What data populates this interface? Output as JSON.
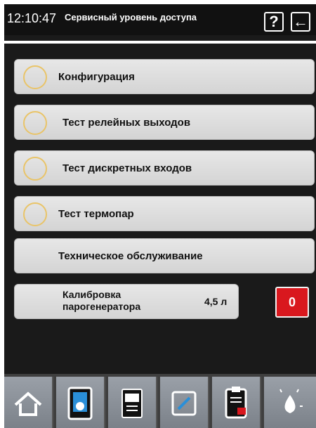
{
  "header": {
    "time": "12:10:47",
    "title": "Сервисный уровень доступа",
    "help_label": "?",
    "back_label": "←"
  },
  "menu": [
    {
      "label": "Конфигурация",
      "icon": "config-icon"
    },
    {
      "label": "Тест релейных выходов",
      "icon": "relay-icon"
    },
    {
      "label": "Тест дискретных входов",
      "icon": "wave-icon"
    },
    {
      "label": "Тест термопар",
      "icon": "thermocouple-icon"
    },
    {
      "label": "Техническое обслуживание",
      "icon": ""
    }
  ],
  "calibration": {
    "label_line1": "Калибровка",
    "label_line2": "парогенератора",
    "value": "4,5 л",
    "counter": "0"
  },
  "bottom_tabs": [
    "home-icon",
    "touch-icon",
    "cookbook-icon",
    "edit-icon",
    "clipboard-icon",
    "clean-icon"
  ],
  "colors": {
    "accent": "#e9c468",
    "alert": "#d9181e",
    "background": "#1a1a1a"
  }
}
